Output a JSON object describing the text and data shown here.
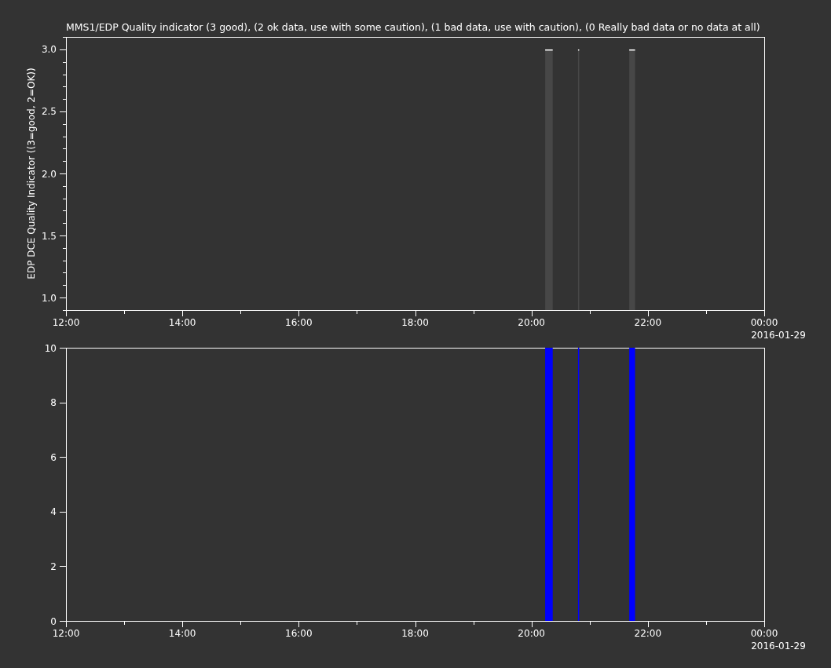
{
  "title": "MMS1/EDP  Quality indicator (3 good), (2 ok data, use with some caution), (1 bad data, use with caution), (0 Really bad data or no data at all)",
  "panels": [
    {
      "date_label": "2016-01-29",
      "chart_data": {
        "type": "bar",
        "ylabel": "EDP DCE Quality Indicator ((3=good, 2=OK))",
        "x": [
          20.3,
          20.81,
          21.73
        ],
        "series": [
          {
            "color": "#474747",
            "values": [
              3,
              3,
              3
            ]
          }
        ],
        "xlim": [
          12,
          24
        ],
        "ylim": [
          0.899,
          3.101
        ],
        "xticks": [
          {
            "value": 12,
            "label": "12:00"
          },
          {
            "value": 14,
            "label": "14:00"
          },
          {
            "value": 16,
            "label": "16:00"
          },
          {
            "value": 18,
            "label": "18:00"
          },
          {
            "value": 20,
            "label": "20:00"
          },
          {
            "value": 22,
            "label": "22:00"
          },
          {
            "value": 24,
            "label": "00:00"
          }
        ],
        "yticks": [
          {
            "value": 1,
            "label": "1.0"
          },
          {
            "value": 1.5,
            "label": "1.5"
          },
          {
            "value": 2,
            "label": "2.0"
          },
          {
            "value": 2.5,
            "label": "2.5"
          },
          {
            "value": 3,
            "label": "3.0"
          }
        ]
      }
    },
    {
      "date_label": "2016-01-29",
      "chart_data": {
        "type": "bar",
        "x": [
          20.3,
          20.81,
          21.73
        ],
        "series": [
          {
            "color": "#0000ff",
            "values": [
              10,
              10,
              10
            ]
          }
        ],
        "xlim": [
          12,
          24
        ],
        "ylim": [
          0,
          10
        ],
        "xticks": [
          {
            "value": 12,
            "label": "12:00"
          },
          {
            "value": 14,
            "label": "14:00"
          },
          {
            "value": 16,
            "label": "16:00"
          },
          {
            "value": 18,
            "label": "18:00"
          },
          {
            "value": 20,
            "label": "20:00"
          },
          {
            "value": 22,
            "label": "22:00"
          },
          {
            "value": 24,
            "label": "00:00"
          }
        ],
        "yticks": [
          0,
          2,
          4,
          6,
          8,
          10
        ]
      }
    }
  ]
}
